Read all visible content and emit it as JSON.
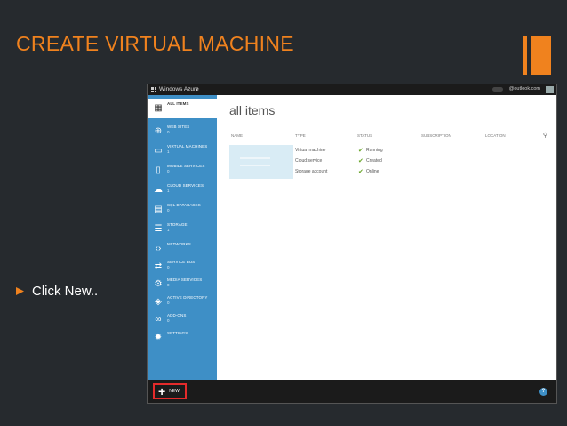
{
  "slide": {
    "title": "CREATE VIRTUAL MACHINE",
    "bullet": "Click New.."
  },
  "colors": {
    "accent": "#f0821e",
    "background": "#262a2e",
    "sidebar": "#3e8fc6",
    "highlight": "#e52b2b"
  },
  "portal": {
    "brand": "Windows Azure",
    "chevron": "∨",
    "account": "@outlook.com",
    "main_title": "all items",
    "columns": [
      "NAME",
      "TYPE",
      "STATUS",
      "SUBSCRIPTION",
      "LOCATION"
    ],
    "nav": [
      {
        "label": "ALL ITEMS",
        "count": "",
        "icon": "grid-icon"
      },
      {
        "label": "WEB SITES",
        "count": "0",
        "icon": "globe-icon"
      },
      {
        "label": "VIRTUAL MACHINES",
        "count": "1",
        "icon": "monitor-icon"
      },
      {
        "label": "MOBILE SERVICES",
        "count": "0",
        "icon": "phone-icon"
      },
      {
        "label": "CLOUD SERVICES",
        "count": "1",
        "icon": "cloud-icon"
      },
      {
        "label": "SQL DATABASES",
        "count": "0",
        "icon": "database-icon"
      },
      {
        "label": "STORAGE",
        "count": "1",
        "icon": "storage-icon"
      },
      {
        "label": "NETWORKS",
        "count": "",
        "icon": "network-icon"
      },
      {
        "label": "SERVICE BUS",
        "count": "0",
        "icon": "service-bus-icon"
      },
      {
        "label": "MEDIA SERVICES",
        "count": "0",
        "icon": "media-icon"
      },
      {
        "label": "ACTIVE DIRECTORY",
        "count": "0",
        "icon": "directory-icon"
      },
      {
        "label": "ADD-ONS",
        "count": "0",
        "icon": "add-ons-icon"
      },
      {
        "label": "SETTINGS",
        "count": "",
        "icon": "gear-icon"
      }
    ],
    "rows": [
      {
        "name": "Virtual machine",
        "status": "Running"
      },
      {
        "name": "Cloud service",
        "status": "Created"
      },
      {
        "name": "Storage account",
        "status": "Online"
      }
    ],
    "new_label": "NEW",
    "help": "?"
  }
}
